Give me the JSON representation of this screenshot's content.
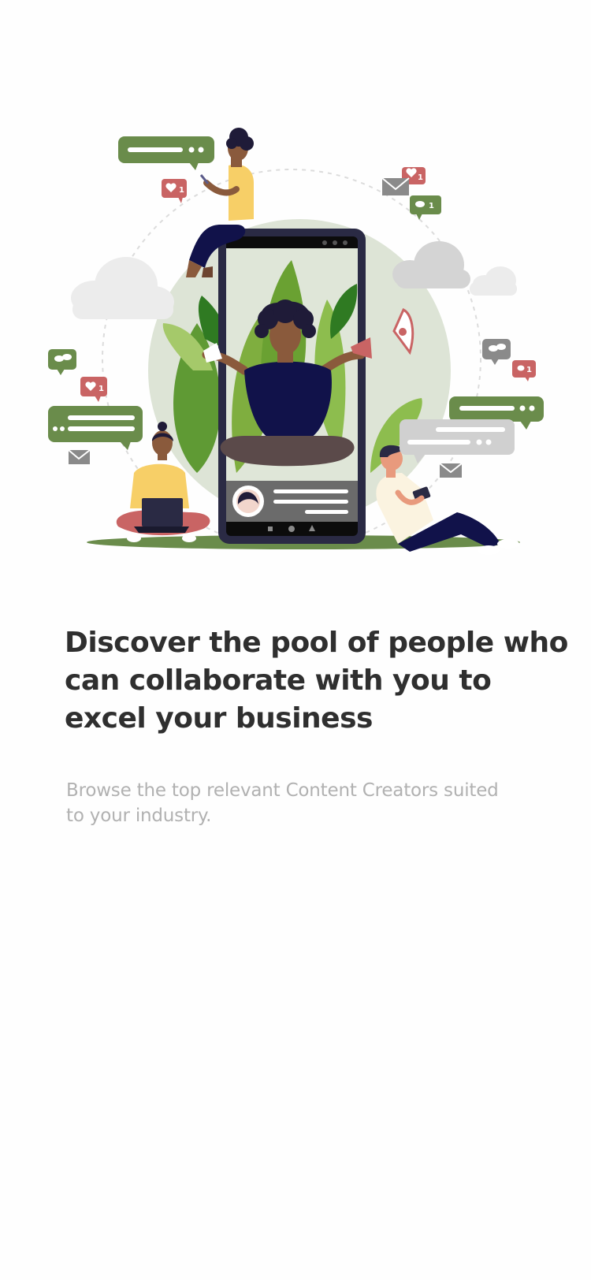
{
  "onboarding": {
    "headline": "Discover the pool of people who can collaborate with you to excel your business",
    "description": "Browse the top relevant Content Creators suited to your industry.",
    "illustration": {
      "icons": [
        "chat-bubble-icon",
        "heart-notification-icon",
        "comment-notification-icon",
        "envelope-icon",
        "megaphone-icon",
        "cloud-icon",
        "smartphone-icon",
        "laptop-icon"
      ],
      "badge_count": "1"
    },
    "colors": {
      "green": "#6a8c4b",
      "red": "#c96464",
      "grey": "#c9c9c9",
      "navy": "#11124a",
      "yellow": "#f7cf67"
    }
  }
}
